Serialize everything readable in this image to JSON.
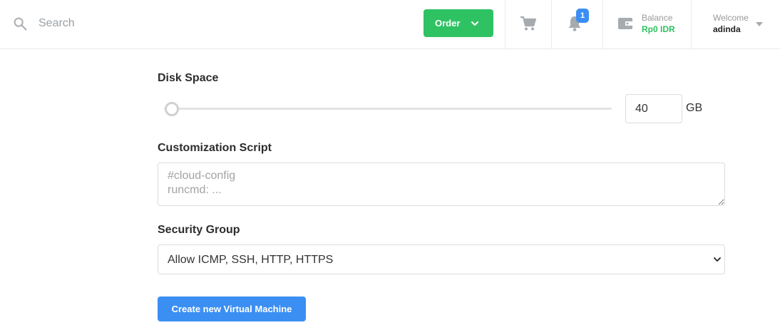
{
  "header": {
    "search_placeholder": "Search",
    "order_label": "Order",
    "notification_count": "1",
    "balance_label": "Balance",
    "balance_value": "Rp0 IDR",
    "welcome_label": "Welcome",
    "username": "adinda"
  },
  "form": {
    "disk_space_label": "Disk Space",
    "disk_space_value": "40",
    "disk_space_unit": "GB",
    "customization_script_label": "Customization Script",
    "customization_script_placeholder": "#cloud-config\nruncmd: ...",
    "security_group_label": "Security Group",
    "security_group_selected": "Allow ICMP, SSH, HTTP, HTTPS",
    "create_button_label": "Create new Virtual Machine"
  },
  "colors": {
    "accent_green": "#2fc263",
    "accent_blue": "#3b8ff3"
  },
  "icons": [
    "search-icon",
    "chevron-down-icon",
    "cart-icon",
    "bell-icon",
    "wallet-icon",
    "caret-down-icon"
  ]
}
